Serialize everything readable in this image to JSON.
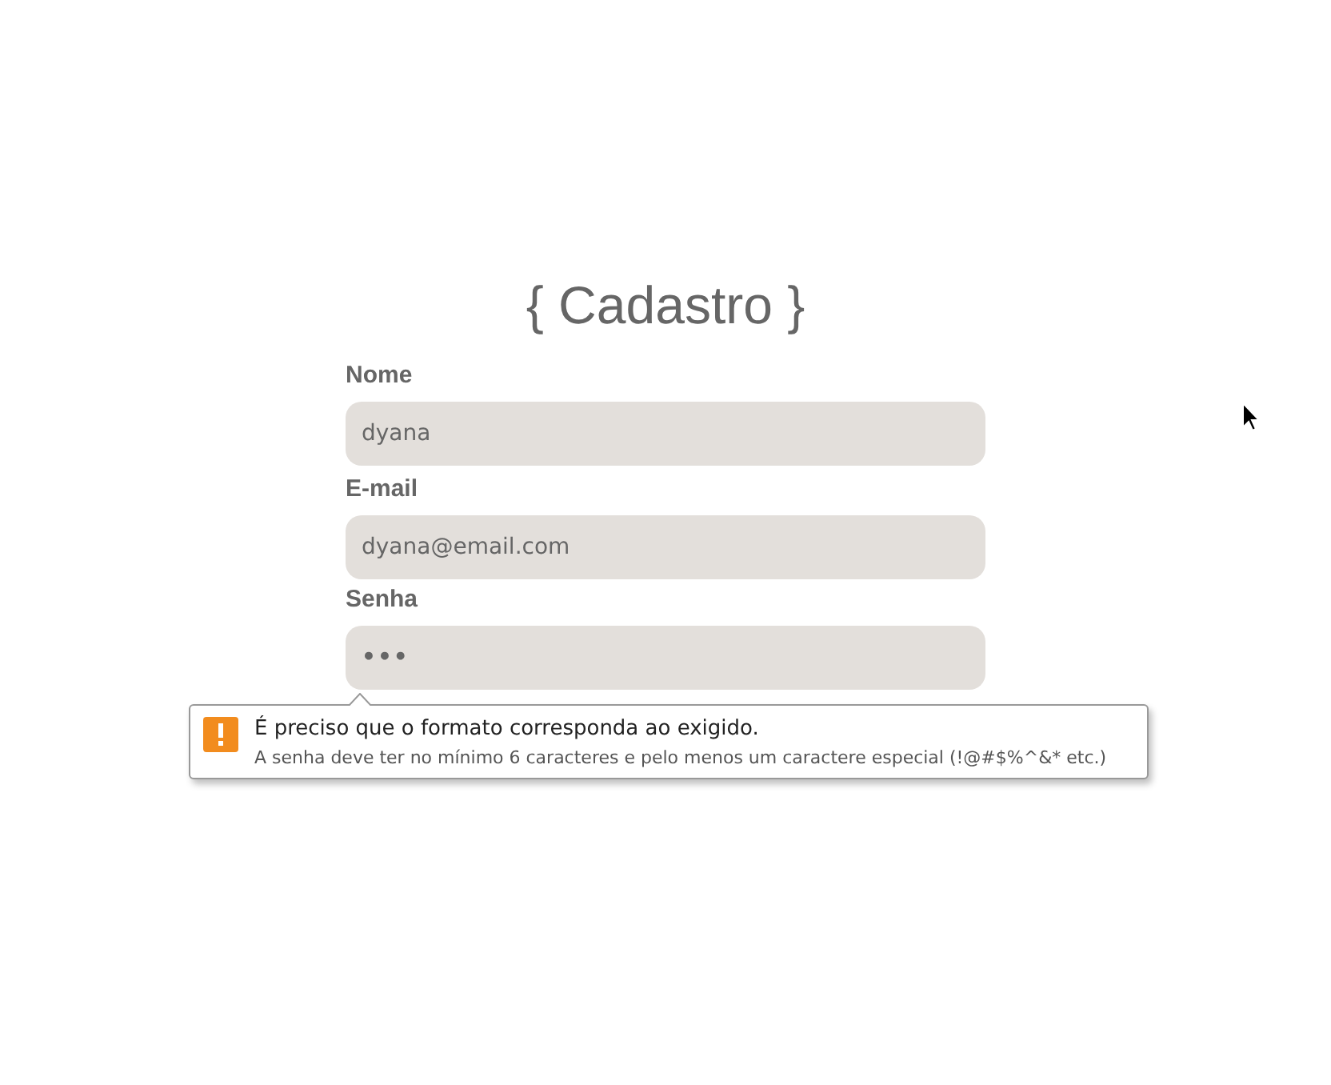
{
  "title": "{ Cadastro }",
  "fields": [
    {
      "label": "Nome",
      "value": "dyana",
      "kind": "text"
    },
    {
      "label": "E-mail",
      "value": "dyana@email.com",
      "kind": "text"
    },
    {
      "label": "Senha",
      "value": "•••",
      "kind": "password",
      "validation_tooltip": {
        "message": "É preciso que o formato corresponda ao exigido.",
        "detail": "A senha deve ter no mínimo 6 caracteres e pelo menos um caractere especial (!@#$%^&* etc.)"
      }
    }
  ]
}
